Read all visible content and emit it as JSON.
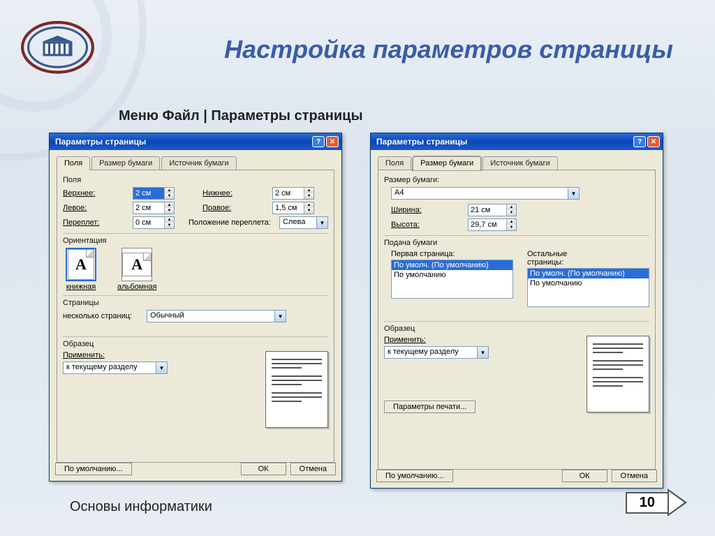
{
  "slide": {
    "title": "Настройка параметров страницы",
    "menu_path": "Меню Файл | Параметры страницы",
    "footer": "Основы информатики",
    "page_number": "10"
  },
  "dialog1": {
    "title": "Параметры страницы",
    "tabs": {
      "fields": "Поля",
      "paper": "Размер бумаги",
      "source": "Источник бумаги"
    },
    "fields_group": "Поля",
    "top_label": "Верхнее:",
    "top_val": "2 см",
    "bottom_label": "Нижнее:",
    "bottom_val": "2 см",
    "left_label": "Левое:",
    "left_val": "2 см",
    "right_label": "Правое:",
    "right_val": "1,5 см",
    "gutter_label": "Переплет:",
    "gutter_val": "0 см",
    "gutter_pos_label": "Положение переплета:",
    "gutter_pos": "Слева",
    "orient_group": "Ориентация",
    "orient_portrait": "книжная",
    "orient_landscape": "альбомная",
    "pages_group": "Страницы",
    "multipage_label": "несколько страниц:",
    "multipage_val": "Обычный",
    "sample_group": "Образец",
    "apply_label": "Применить:",
    "apply_val": "к текущему разделу",
    "btn_default": "По умолчанию...",
    "btn_ok": "ОК",
    "btn_cancel": "Отмена"
  },
  "dialog2": {
    "title": "Параметры страницы",
    "tabs": {
      "fields": "Поля",
      "paper": "Размер бумаги",
      "source": "Источник бумаги"
    },
    "size_group": "Размер бумаги:",
    "size_val": "A4",
    "width_label": "Ширина:",
    "width_val": "21 см",
    "height_label": "Высота:",
    "height_val": "29,7 см",
    "feed_group": "Подача бумаги",
    "first_label": "Первая страница:",
    "other_label": "Остальные страницы:",
    "list_sel": "По умолч. (По умолчанию)",
    "list_item": "По умолчанию",
    "sample_group": "Образец",
    "apply_label": "Применить:",
    "apply_val": "к текущему разделу",
    "btn_print": "Параметры печати...",
    "btn_default": "По умолчанию...",
    "btn_ok": "ОК",
    "btn_cancel": "Отмена"
  }
}
